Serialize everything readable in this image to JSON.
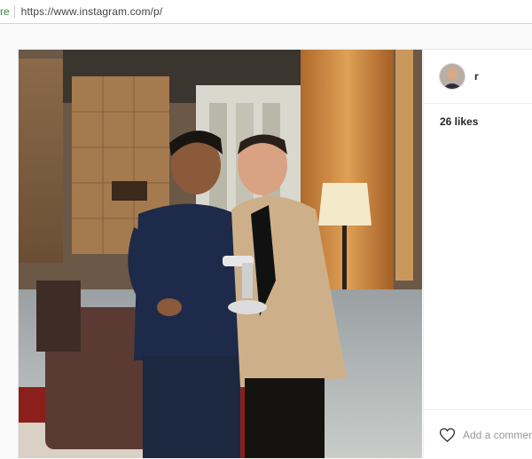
{
  "browser": {
    "url_prefix": "re",
    "url": "https://www.instagram.com/p/"
  },
  "post": {
    "username": "r",
    "likes_text": "26 likes",
    "comment_placeholder": "Add a comment",
    "icons": {
      "like": "heart-icon"
    }
  },
  "colors": {
    "secure_green": "#2f8d3f",
    "text": "#262626",
    "muted": "#999999",
    "border": "#efefef"
  }
}
